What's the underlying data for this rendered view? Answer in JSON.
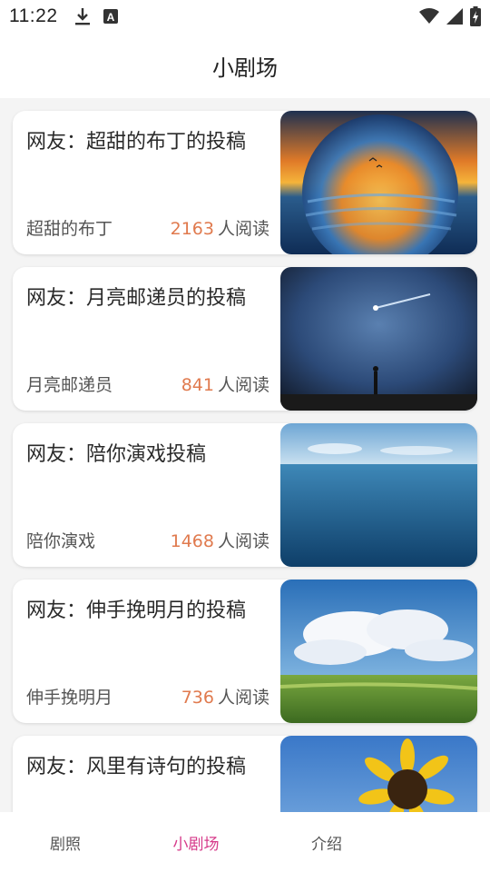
{
  "status": {
    "time": "11:22",
    "icons": [
      "download-icon",
      "font-a-icon",
      "wifi-icon",
      "signal-icon",
      "battery-charging-icon"
    ]
  },
  "header": {
    "title": "小剧场"
  },
  "cards": [
    {
      "title": "网友：超甜的布丁的投稿",
      "author": "超甜的布丁",
      "reads": "2163",
      "reads_suffix": "人阅读",
      "thumb": "sunset-sphere-image"
    },
    {
      "title": "网友：月亮邮递员的投稿",
      "author": "月亮邮递员",
      "reads": "841",
      "reads_suffix": "人阅读",
      "thumb": "night-meteor-image"
    },
    {
      "title": "网友：陪你演戏投稿",
      "author": "陪你演戏",
      "reads": "1468",
      "reads_suffix": "人阅读",
      "thumb": "ocean-horizon-image"
    },
    {
      "title": "网友：伸手挽明月的投稿",
      "author": "伸手挽明月",
      "reads": "736",
      "reads_suffix": "人阅读",
      "thumb": "grassland-clouds-image"
    },
    {
      "title": "网友：风里有诗句的投稿",
      "author": "",
      "reads": "",
      "reads_suffix": "",
      "thumb": "sunflower-sky-image"
    }
  ],
  "tabs": [
    {
      "label": "剧照",
      "active": false
    },
    {
      "label": "小剧场",
      "active": true
    },
    {
      "label": "介绍",
      "active": false
    }
  ],
  "colors": {
    "accent": "#d63a8a",
    "read_count": "#e07a4e"
  }
}
